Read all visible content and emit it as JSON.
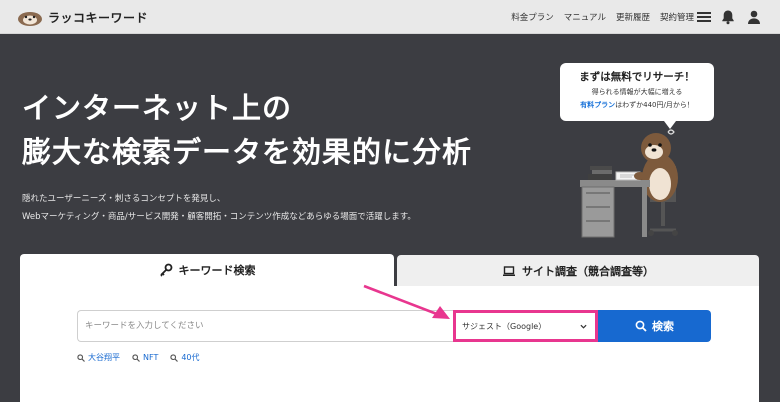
{
  "header": {
    "brand": "ラッコキーワード",
    "nav": [
      "料金プラン",
      "マニュアル",
      "更新履歴",
      "契約管理"
    ]
  },
  "hero": {
    "title_line1": "インターネット上の",
    "title_line2": "膨大な検索データを効果的に分析",
    "sub_line1": "隠れたユーザーニーズ・刺さるコンセプトを発見し、",
    "sub_line2": "Webマーケティング・商品/サービス開発・顧客開拓・コンテンツ作成などあらゆる場面で活躍します。"
  },
  "bubble": {
    "title": "まずは無料でリサーチ！",
    "line1": "得られる情報が大幅に増える",
    "link": "有料プラン",
    "line2_rest": "はわずか440円/月から！"
  },
  "tabs": {
    "keyword": "キーワード検索",
    "site": "サイト調査（競合調査等）"
  },
  "search": {
    "placeholder": "キーワードを入力してください",
    "select_value": "サジェスト（Google）",
    "button": "検索",
    "suggestions": [
      "大谷翔平",
      "NFT",
      "40代"
    ]
  },
  "colors": {
    "accent": "#1769d0",
    "highlight": "#e8368f",
    "background": "#3c3d42"
  }
}
